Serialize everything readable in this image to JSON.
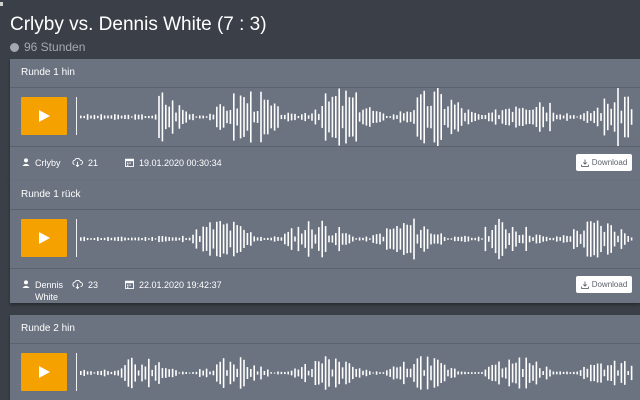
{
  "match": {
    "title": "Crlyby vs. Dennis White (7 : 3)",
    "status_text": "96 Stunden",
    "status_dot_color": "#a4a9b0"
  },
  "accent_color": "#f5a100",
  "rounds": [
    {
      "label": "Runde 1 hin",
      "user": "Crlyby",
      "downloads": "21",
      "date": "19.01.2020 00:30:34",
      "download_label": "Download",
      "waveform": {
        "seed": 3,
        "quiet_until": 0.14,
        "gap_from": 0.72,
        "gap_to": 0.73,
        "quiet_amp": 0.04,
        "loud_amp": 0.55
      }
    },
    {
      "label": "Runde 1 rück",
      "user": "Dennis White",
      "downloads": "23",
      "date": "22.01.2020 19:42:37",
      "download_label": "Download",
      "waveform": {
        "seed": 11,
        "quiet_until": 0.14,
        "gap_from": 0.7,
        "gap_to": 0.73,
        "quiet_amp": 0.03,
        "loud_amp": 0.38
      }
    },
    {
      "label": "Runde 2 hin",
      "waveform": {
        "seed": 29,
        "quiet_until": 0.0,
        "gap_from": 0.0,
        "gap_to": 0.0,
        "quiet_amp": 0.03,
        "loud_amp": 0.3
      }
    }
  ],
  "icons": {
    "play": "play-icon",
    "user": "user-icon",
    "downloads": "cloud-download-icon",
    "date": "calendar-icon",
    "download_button": "download-icon"
  }
}
